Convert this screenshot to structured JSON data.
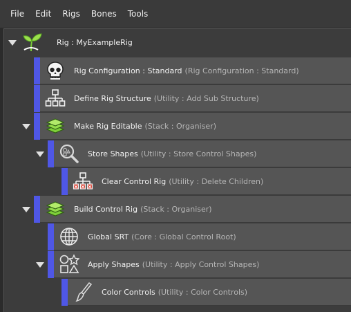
{
  "menu": [
    "File",
    "Edit",
    "Rigs",
    "Bones",
    "Tools"
  ],
  "tree": {
    "root": {
      "name": "Rig : MyExampleRig",
      "icon": "sprout-icon"
    },
    "rows": [
      {
        "name": "Rig Configuration : Standard",
        "type": "(Rig Configuration : Standard)",
        "icon": "skull-icon"
      },
      {
        "name": "Define Rig Structure",
        "type": "(Utility : Add Sub Structure)",
        "icon": "hierarchy-icon"
      },
      {
        "name": "Make Rig Editable",
        "type": "(Stack : Organiser)",
        "icon": "layers-icon"
      },
      {
        "name": "Store Shapes",
        "type": "(Utility : Store Control Shapes)",
        "icon": "magnify-shapes-icon"
      },
      {
        "name": "Clear Control Rig",
        "type": "(Utility : Delete Children)",
        "icon": "delete-hierarchy-icon"
      },
      {
        "name": "Build Control Rig",
        "type": "(Stack : Organiser)",
        "icon": "layers-icon"
      },
      {
        "name": "Global SRT",
        "type": "(Core : Global Control Root)",
        "icon": "globe-icon"
      },
      {
        "name": "Apply Shapes",
        "type": "(Utility : Apply Control Shapes)",
        "icon": "shapes-icon"
      },
      {
        "name": "Color Controls",
        "type": "(Utility : Color Controls)",
        "icon": "brush-icon"
      }
    ]
  }
}
